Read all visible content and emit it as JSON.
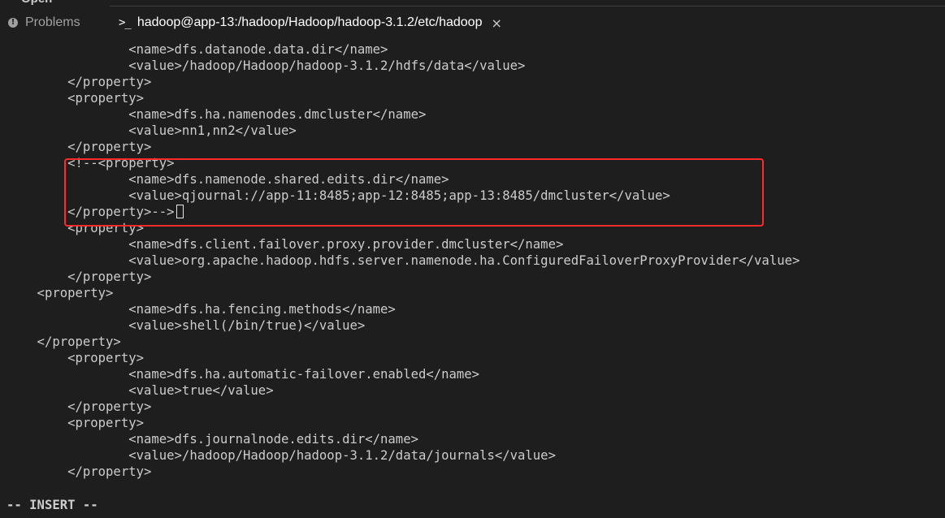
{
  "top_fragment": "Open",
  "tabs": {
    "problems": {
      "label": "Problems",
      "icon": "info-icon"
    },
    "terminal": {
      "label": "hadoop@app-13:/hadoop/Hadoop/hadoop-3.1.2/etc/hadoop",
      "icon": "terminal-icon",
      "close": "×"
    }
  },
  "terminal": {
    "lines": [
      "                <name>dfs.datanode.data.dir</name>",
      "                <value>/hadoop/Hadoop/hadoop-3.1.2/hdfs/data</value>",
      "        </property>",
      "        <property>",
      "                <name>dfs.ha.namenodes.dmcluster</name>",
      "                <value>nn1,nn2</value>",
      "        </property>",
      "        <!--<property>",
      "                <name>dfs.namenode.shared.edits.dir</name>",
      "                <value>qjournal://app-11:8485;app-12:8485;app-13:8485/dmcluster</value>",
      "        </property>-->",
      "        <property>",
      "                <name>dfs.client.failover.proxy.provider.dmcluster</name>",
      "                <value>org.apache.hadoop.hdfs.server.namenode.ha.ConfiguredFailoverProxyProvider</value>",
      "        </property>",
      "    <property>",
      "                <name>dfs.ha.fencing.methods</name>",
      "                <value>shell(/bin/true)</value>",
      "    </property>",
      "        <property>",
      "                <name>dfs.ha.automatic-failover.enabled</name>",
      "                <value>true</value>",
      "        </property>",
      "        <property>",
      "                <name>dfs.journalnode.edits.dir</name>",
      "                <value>/hadoop/Hadoop/hadoop-3.1.2/data/journals</value>",
      "        </property>",
      ""
    ],
    "mode": "-- INSERT --"
  },
  "colors": {
    "background": "#1e1e1e",
    "text": "#cccccc",
    "highlight": "#ff2b2b"
  }
}
